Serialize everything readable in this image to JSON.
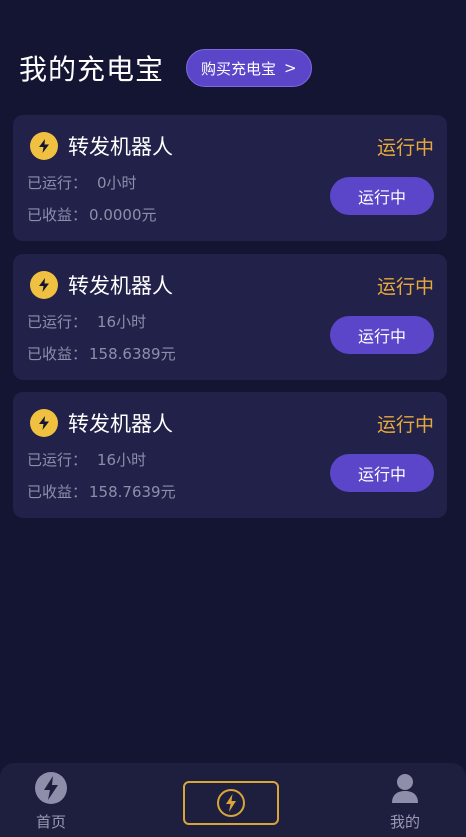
{
  "header": {
    "title": "我的充电宝",
    "buy_label": "购买充电宝",
    "buy_chevron": ">"
  },
  "cards": [
    {
      "name": "转发机器人",
      "status": "运行中",
      "runtime_label": "已运行：",
      "runtime_value": "0小时",
      "earnings_label": "已收益：",
      "earnings_value": "0.0000元",
      "button_label": "运行中"
    },
    {
      "name": "转发机器人",
      "status": "运行中",
      "runtime_label": "已运行：",
      "runtime_value": "16小时",
      "earnings_label": "已收益：",
      "earnings_value": "158.6389元",
      "button_label": "运行中"
    },
    {
      "name": "转发机器人",
      "status": "运行中",
      "runtime_label": "已运行：",
      "runtime_value": "16小时",
      "earnings_label": "已收益：",
      "earnings_value": "158.7639元",
      "button_label": "运行中"
    }
  ],
  "tabbar": {
    "home_label": "首页",
    "mine_label": "我的",
    "home_icon": "lightning-bolt-icon",
    "center_icon": "lightning-bolt-icon",
    "mine_icon": "user-icon"
  },
  "colors": {
    "background": "#141433",
    "card": "#21214a",
    "accent_purple": "#5b45c8",
    "status_orange": "#e8a93b",
    "icon_yellow": "#f0c040"
  }
}
